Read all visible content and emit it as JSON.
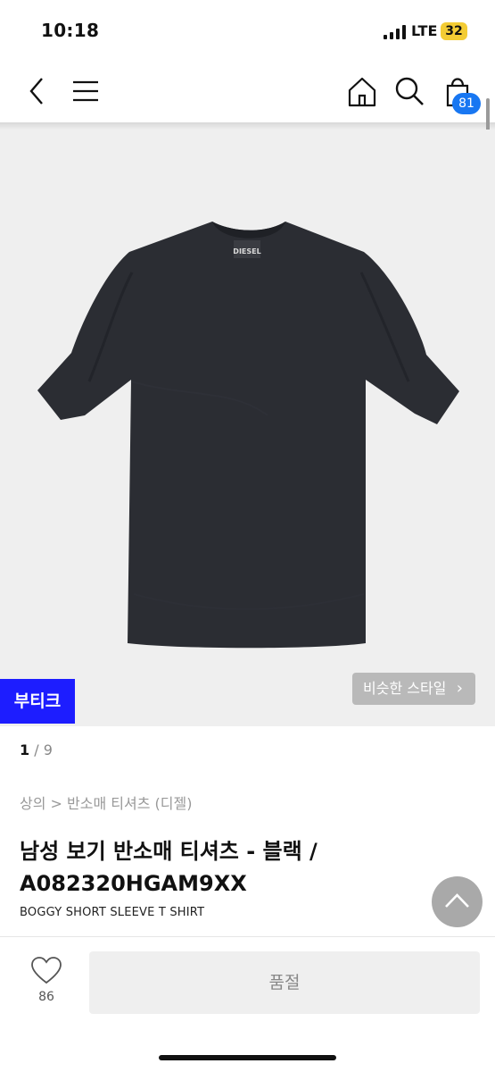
{
  "status_bar": {
    "time": "10:18",
    "network": "LTE",
    "battery": "32"
  },
  "nav": {
    "cart_count": "81"
  },
  "product_image": {
    "brand_tag": "DIESEL",
    "garment_color": "#2b2d33"
  },
  "badges": {
    "boutique": "부티크",
    "similar_style": "비슷한 스타일"
  },
  "pager": {
    "current": "1",
    "separator": " / ",
    "total": "9"
  },
  "product": {
    "breadcrumb": "상의 > 반소매 티셔츠 (디젤)",
    "title": "남성 보기 반소매 티셔츠 - 블랙 / A082320HGAM9XX",
    "subtitle": "BOGGY SHORT SLEEVE T SHIRT"
  },
  "bottom_bar": {
    "like_count": "86",
    "action_label": "품절"
  },
  "colors": {
    "brand_blue": "#1d1dff",
    "badge_blue": "#1877f2"
  }
}
